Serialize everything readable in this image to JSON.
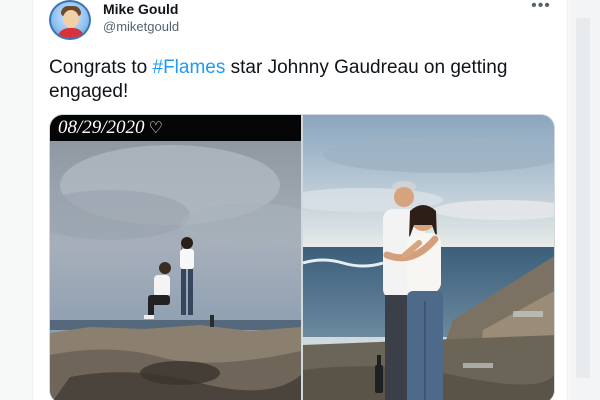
{
  "tweet": {
    "author": {
      "display_name": "Mike Gould",
      "handle": "@miketgould",
      "avatar_icon": "avatar-caricature"
    },
    "more_menu_glyph": "•••",
    "text": {
      "before": "Congrats to ",
      "hashtag": "#Flames",
      "after": " star Johnny Gaudreau on getting engaged!"
    },
    "media": {
      "left_photo": {
        "banner_date": "08/29/2020",
        "banner_icon": "♡"
      },
      "right_photo": {}
    }
  },
  "colors": {
    "link": "#1d9bf0",
    "text": "#0f1419",
    "secondary_text": "#536471"
  }
}
